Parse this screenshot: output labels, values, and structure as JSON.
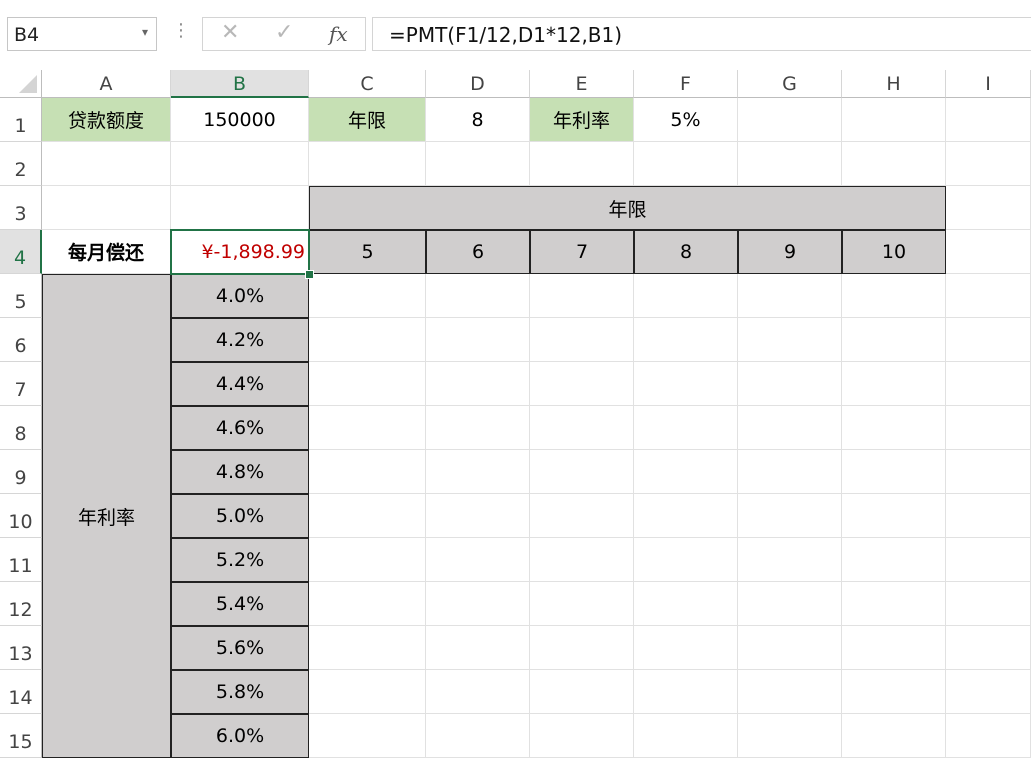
{
  "formula_bar": {
    "name_box": "B4",
    "formula": "=PMT(F1/12,D1*12,B1)",
    "fx_label": "fx",
    "cancel_glyph": "✕",
    "enter_glyph": "✓"
  },
  "columns": [
    "A",
    "B",
    "C",
    "D",
    "E",
    "F",
    "G",
    "H",
    "I"
  ],
  "rows": [
    "1",
    "2",
    "3",
    "4",
    "5",
    "6",
    "7",
    "8",
    "9",
    "10",
    "11",
    "12",
    "13",
    "14",
    "15"
  ],
  "selected_cell": "B4",
  "colors": {
    "label_green": "#c6e0b4",
    "table_gray": "#d0cece",
    "selection_green": "#217346",
    "negative_red": "#c00000"
  },
  "cells": {
    "A1": "贷款额度",
    "B1": "150000",
    "C1": "年限",
    "D1": "8",
    "E1": "年利率",
    "F1": "5%",
    "C3": "年限",
    "A4": "每月偿还",
    "B4": "¥-1,898.99",
    "C4": "5",
    "D4": "6",
    "E4": "7",
    "F4": "8",
    "G4": "9",
    "H4": "10",
    "A5": "年利率",
    "B5": "4.0%",
    "B6": "4.2%",
    "B7": "4.4%",
    "B8": "4.6%",
    "B9": "4.8%",
    "B10": "5.0%",
    "B11": "5.2%",
    "B12": "5.4%",
    "B13": "5.6%",
    "B14": "5.8%",
    "B15": "6.0%"
  },
  "merged": [
    {
      "start": "C3",
      "end": "H3"
    },
    {
      "start": "A5",
      "end": "A15"
    }
  ]
}
